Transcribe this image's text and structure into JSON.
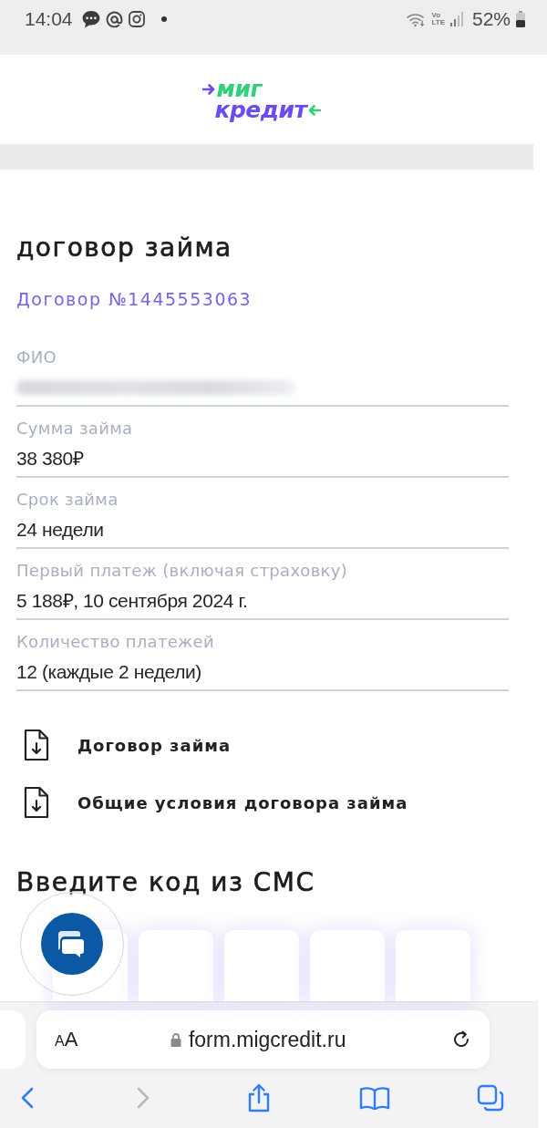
{
  "status_bar": {
    "time": "14:04",
    "network": {
      "top": "Vo",
      "bottom": "LTE"
    },
    "battery": "52%"
  },
  "logo": {
    "top": "миг",
    "bottom": "кредит"
  },
  "contract": {
    "title": "договор займа",
    "number_link": "Договор №1445553063",
    "fields": [
      {
        "label": "ФИО",
        "kind": "hidden"
      },
      {
        "label": "Сумма займа",
        "kind": "text",
        "value": "38 380₽"
      },
      {
        "label": "Срок займа",
        "kind": "text",
        "value": "24 недели"
      },
      {
        "label": "Первый платеж (включая страховку)",
        "kind": "text",
        "value": "5 188₽, 10 сентября 2024 г."
      },
      {
        "label": "Количество платежей",
        "kind": "text",
        "value": "12 (каждые 2 недели)"
      }
    ]
  },
  "documents": [
    {
      "title": "Договор займа"
    },
    {
      "title": "Общие условия договора займа"
    }
  ],
  "sms": {
    "title": "Введите код из СМС",
    "boxes": [
      {
        "kind": "digit"
      },
      {
        "kind": "digit"
      },
      {
        "kind": "digit"
      },
      {
        "kind": "digit"
      },
      {
        "kind": "digit"
      }
    ]
  },
  "browser": {
    "text_size_button": "AA",
    "url": "form.migcredit.ru",
    "back_disabled": false,
    "forward_disabled": true
  }
}
